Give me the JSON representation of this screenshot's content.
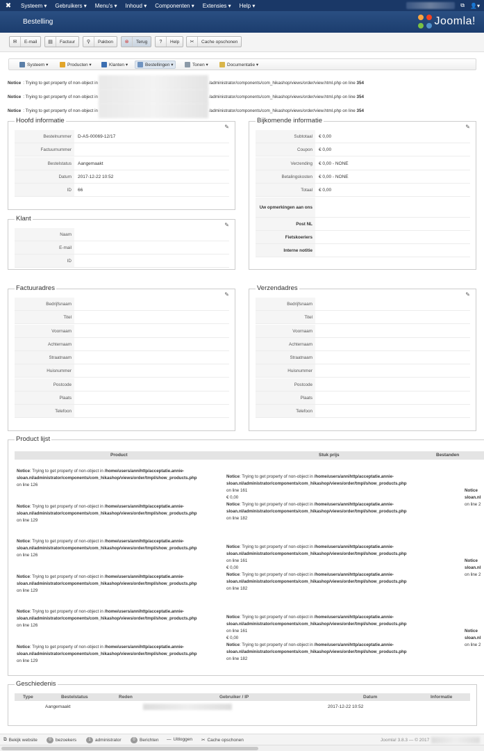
{
  "topnav": {
    "menu": [
      "Systeem ▾",
      "Gebruikers ▾",
      "Menu's ▾",
      "Inhoud ▾",
      "Componenten ▾",
      "Extensies ▾",
      "Help ▾"
    ],
    "icons": [
      "joomla-icon",
      "external-link-icon",
      "user-icon"
    ],
    "user_caret": "▾"
  },
  "header": {
    "title": "Bestelling",
    "brand": "Joomla!"
  },
  "toolbar": {
    "buttons": [
      {
        "label": "E-mail",
        "icon": "✉"
      },
      {
        "label": "Factuur",
        "icon": "▤"
      },
      {
        "label": "Pakbon",
        "icon": "⚲"
      },
      {
        "label": "Terug",
        "icon": "⊗"
      },
      {
        "label": "Help",
        "icon": "?"
      },
      {
        "label": "Cache opschonen",
        "icon": "✂"
      }
    ]
  },
  "submenu": {
    "items": [
      {
        "label": "Systeem ▾",
        "color": "#5b7fa8"
      },
      {
        "label": "Producten ▾",
        "color": "#e2a52a"
      },
      {
        "label": "Klanten ▾",
        "color": "#3c6fb2"
      },
      {
        "label": "Bestellingen ▾",
        "color": "#6f93c0"
      },
      {
        "label": "Tonen ▾",
        "color": "#8c9aa8"
      },
      {
        "label": "Documentatie ▾",
        "color": "#d9b54a"
      }
    ]
  },
  "notices": {
    "label": "Notice",
    "text": ": Trying to get property of non-object in",
    "path": "/administrator/components/com_hikashop/views/order/view.html.php",
    "on_line": "on line",
    "line": "354"
  },
  "hoofd": {
    "title": "Hoofd informatie",
    "rows": [
      {
        "k": "Bestelnummer",
        "v": "D-AS-00069-12/17"
      },
      {
        "k": "Factuurnummer",
        "v": ""
      },
      {
        "k": "Bestelstatus",
        "v": "Aangemaakt"
      },
      {
        "k": "Datum",
        "v": "2017-12-22 10:52"
      },
      {
        "k": "ID",
        "v": "66"
      }
    ]
  },
  "bijkomende": {
    "title": "Bijkomende informatie",
    "rows": [
      {
        "k": "Subtotaal",
        "v": "€ 0,00"
      },
      {
        "k": "Coupon",
        "v": "€ 0,00"
      },
      {
        "k": "Verzending",
        "v": "€ 0,00 - NONE"
      },
      {
        "k": "Betalingskosten",
        "v": "€ 0,00 - NONE"
      },
      {
        "k": "Totaal",
        "v": "€ 0,00"
      },
      {
        "k": "Uw opmerkingen aan ons",
        "v": ""
      },
      {
        "k": "Post NL",
        "v": ""
      },
      {
        "k": "Fietskoeriers",
        "v": ""
      },
      {
        "k": "Interne notitie",
        "v": ""
      }
    ]
  },
  "klant": {
    "title": "Klant",
    "rows": [
      {
        "k": "Naam",
        "v": ""
      },
      {
        "k": "E-mail",
        "v": ""
      },
      {
        "k": "ID",
        "v": ""
      }
    ]
  },
  "factuuradres": {
    "title": "Factuuradres",
    "rows": [
      "Bedrijfsnaam",
      "Titel",
      "Voornaam",
      "Achternaam",
      "Straatnaam",
      "Huisnummer",
      "Postcode",
      "Plaats",
      "Telefoon"
    ]
  },
  "verzendadres": {
    "title": "Verzendadres",
    "rows": [
      "Bedrijfsnaam",
      "Titel",
      "Voornaam",
      "Achternaam",
      "Straatnaam",
      "Huisnummer",
      "Postcode",
      "Plaats",
      "Telefoon"
    ]
  },
  "productlijst": {
    "title": "Product lijst",
    "headers": [
      "Product",
      "Stuk prijs",
      "Bestanden"
    ],
    "n_label": "Notice",
    "n_text": ": Trying to get property of non-object in",
    "path_a": "/home/users/annihttp/acceptatie.annie-",
    "path_b": "sloan.nl/administrator/components/com_hikashop/views/order/tmpl/show_products.php",
    "line_126": "on line 126",
    "line_129": "on line 129",
    "line_161": "on line 161",
    "line_182": "on line 182",
    "price": "€ 0,00",
    "trunc_notice": "Notice",
    "trunc_path": "sloan.nl",
    "trunc_line": "on line 2"
  },
  "geschiedenis": {
    "title": "Geschiedenis",
    "headers": [
      "Type",
      "Bestelstatus",
      "Reden",
      "Gebruiker / IP",
      "Datum",
      "Informatie"
    ],
    "row": {
      "bestelstatus": "Aangemaakt",
      "datum": "2017-12-22 10:52"
    }
  },
  "statusbar": {
    "bekijk": "Bekijk website",
    "bezoekers_count": "0",
    "bezoekers": "bezoekers",
    "admin_count": "1",
    "admin": "administrator",
    "berichten_count": "0",
    "berichten": "Berichten",
    "uitloggen": "Uitloggen",
    "cache": "Cache opschonen",
    "version": "Joomla! 3.8.3 — © 2017"
  }
}
